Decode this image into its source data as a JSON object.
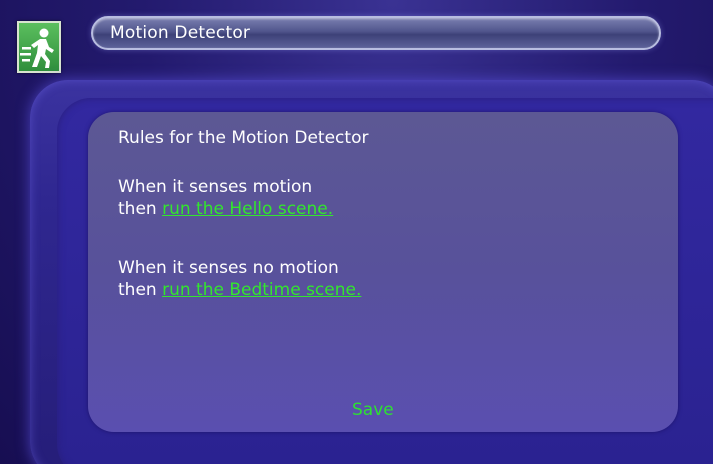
{
  "header": {
    "title": "Motion Detector",
    "icon": "motion-detector-icon"
  },
  "content": {
    "heading": "Rules for the Motion Detector",
    "rules": [
      {
        "condition": "When it senses motion",
        "then_label": "then",
        "action": "run the Hello scene."
      },
      {
        "condition": "When it senses no motion",
        "then_label": "then",
        "action": "run the Bedtime scene."
      }
    ],
    "save_label": "Save"
  },
  "colors": {
    "link": "#33e62e",
    "text": "#ffffff",
    "panel": "#58519b",
    "background": "#231a6e"
  }
}
